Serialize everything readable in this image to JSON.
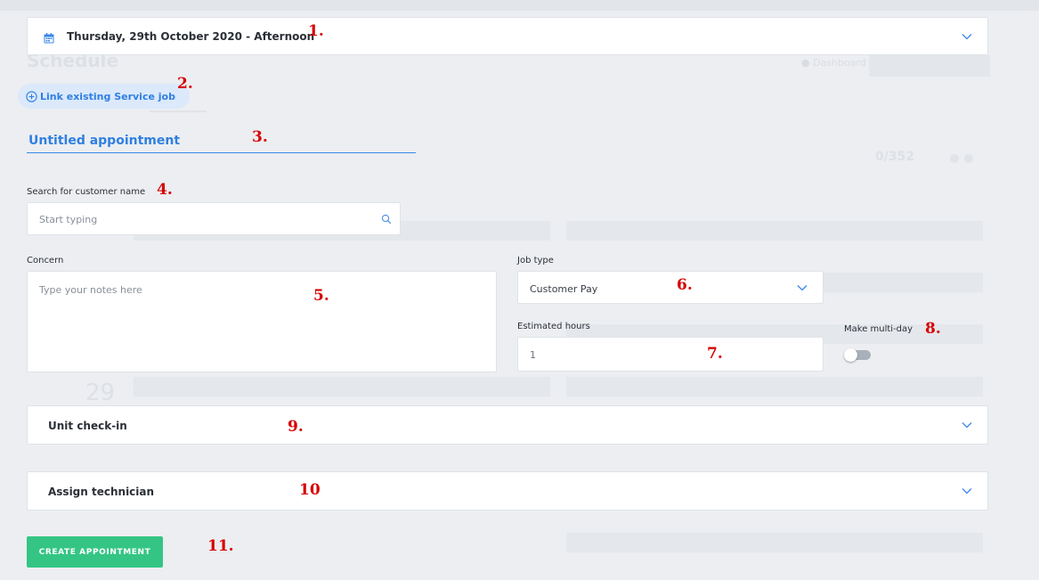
{
  "header": {
    "date_label": "Thursday, 29th October 2020 - Afternoon"
  },
  "link_service_job": {
    "label": "Link existing Service job"
  },
  "appointment_title": "Untitled appointment",
  "customer_search": {
    "label": "Search for customer name",
    "placeholder": "Start typing"
  },
  "concern": {
    "label": "Concern",
    "placeholder": "Type your notes here"
  },
  "job_type": {
    "label": "Job type",
    "selected": "Customer Pay"
  },
  "estimated_hours": {
    "label": "Estimated hours",
    "value": "1"
  },
  "multi_day": {
    "label": "Make multi-day",
    "enabled": false
  },
  "sections": {
    "unit_checkin": "Unit check-in",
    "assign_technician": "Assign technician"
  },
  "create_button": {
    "label": "CREATE APPOINTMENT"
  },
  "annotations": [
    "1.",
    "2.",
    "3.",
    "4.",
    "5.",
    "6.",
    "7.",
    "8.",
    "9.",
    "10",
    "11."
  ],
  "colors": {
    "accent_blue": "#2f7fe2",
    "create_green": "#34c584",
    "annotation_red": "#d80000",
    "background": "#eceef1"
  }
}
